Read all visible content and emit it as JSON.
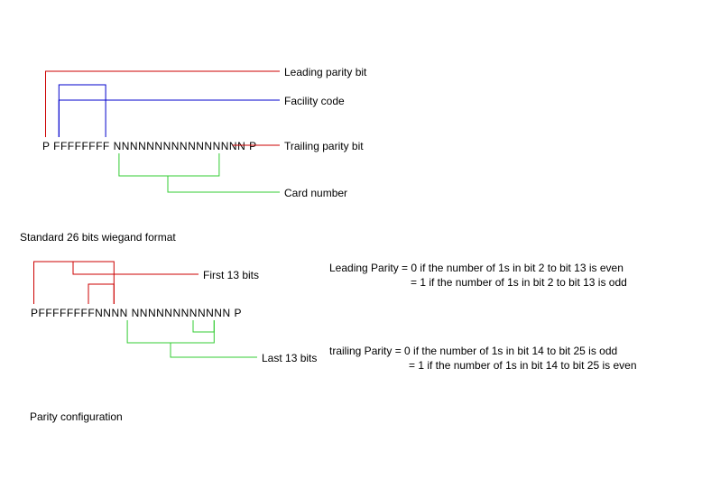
{
  "colors": {
    "red": "#cc0000",
    "blue": "#0000cc",
    "green": "#33cc33",
    "black": "#000000"
  },
  "top_diagram": {
    "bit_string": "P FFFFFFFF NNNNNNNNNNNNNNNN P",
    "labels": {
      "leading_parity": "Leading parity bit",
      "facility_code": "Facility code",
      "trailing_parity": "Trailing parity bit",
      "card_number": "Card number"
    },
    "caption": "Standard 26 bits wiegand format"
  },
  "bottom_diagram": {
    "bit_string": "PFFFFFFFFNNNN NNNNNNNNNNNN P",
    "labels": {
      "first13": "First 13 bits",
      "last13": "Last 13 bits"
    },
    "explain": {
      "leading_line1": "Leading Parity = 0 if the number of 1s in bit 2 to bit 13 is even",
      "leading_line2": "= 1 if the number of 1s in bit 2 to bit 13 is odd",
      "trailing_line1": "trailing Parity = 0 if the number of 1s in bit 14 to bit 25 is odd",
      "trailing_line2": "= 1 if the number of 1s in bit 14 to bit 25 is even"
    },
    "caption": "Parity configuration"
  }
}
